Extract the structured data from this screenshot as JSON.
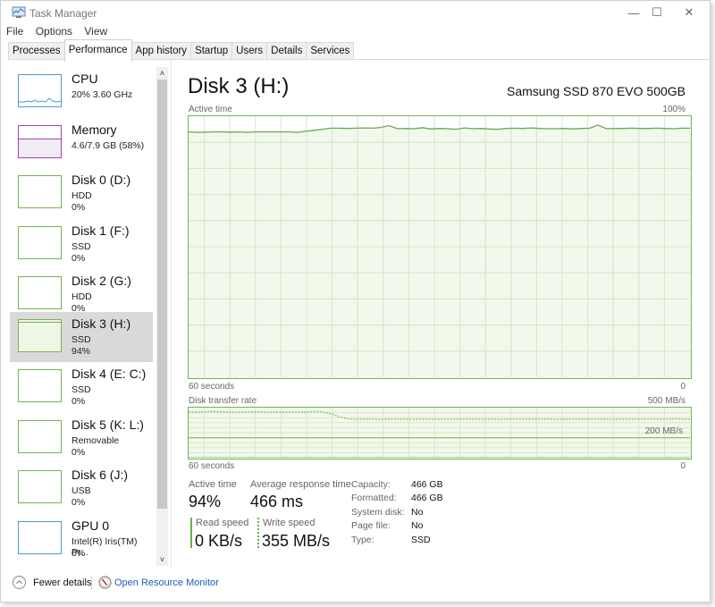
{
  "window": {
    "title": "Task Manager",
    "icons": {
      "app": "task-manager-icon",
      "minimize": "minimize-icon",
      "maximize": "maximize-icon",
      "close": "close-icon"
    },
    "minimize_glyph": "—",
    "maximize_glyph": "☐",
    "close_glyph": "✕"
  },
  "menu": [
    "File",
    "Options",
    "View"
  ],
  "tabs": [
    {
      "label": "Processes",
      "active": false
    },
    {
      "label": "Performance",
      "active": true
    },
    {
      "label": "App history",
      "active": false
    },
    {
      "label": "Startup",
      "active": false
    },
    {
      "label": "Users",
      "active": false
    },
    {
      "label": "Details",
      "active": false
    },
    {
      "label": "Services",
      "active": false
    }
  ],
  "sidebar": {
    "items": [
      {
        "name": "CPU",
        "sub": "20%  3.60 GHz",
        "val": "",
        "kind": "cpu",
        "color": "#4a9bd1",
        "selected": false
      },
      {
        "name": "Memory",
        "sub": "4.6/7.9 GB (58%)",
        "val": "",
        "kind": "memory",
        "color": "#a33eb8",
        "selected": false
      },
      {
        "name": "Disk 0 (D:)",
        "sub": "HDD",
        "val": "0%",
        "kind": "disk",
        "color": "#77b255",
        "selected": false
      },
      {
        "name": "Disk 1 (F:)",
        "sub": "SSD",
        "val": "0%",
        "kind": "disk",
        "color": "#77b255",
        "selected": false
      },
      {
        "name": "Disk 2 (G:)",
        "sub": "HDD",
        "val": "0%",
        "kind": "disk",
        "color": "#77b255",
        "selected": false
      },
      {
        "name": "Disk 3 (H:)",
        "sub": "SSD",
        "val": "94%",
        "kind": "disk",
        "color": "#77b255",
        "selected": true
      },
      {
        "name": "Disk 4 (E: C:)",
        "sub": "SSD",
        "val": "0%",
        "kind": "disk",
        "color": "#77b255",
        "selected": false
      },
      {
        "name": "Disk 5 (K: L:)",
        "sub": "Removable",
        "val": "0%",
        "kind": "disk",
        "color": "#77b255",
        "selected": false
      },
      {
        "name": "Disk 6 (J:)",
        "sub": "USB",
        "val": "0%",
        "kind": "disk",
        "color": "#77b255",
        "selected": false
      },
      {
        "name": "GPU 0",
        "sub": "Intel(R) Iris(TM) Pr...",
        "val": "0%",
        "kind": "gpu",
        "color": "#4a9bd1",
        "selected": false
      }
    ],
    "scroll_up_glyph": "˄",
    "scroll_down_glyph": "˅"
  },
  "main": {
    "title": "Disk 3 (H:)",
    "model": "Samsung SSD 870 EVO 500GB",
    "active_chart": {
      "label": "Active time",
      "max_label": "100%",
      "time_label": "60 seconds",
      "min_label": "0"
    },
    "transfer_chart": {
      "label": "Disk transfer rate",
      "max_label": "500 MB/s",
      "mid_label": "200 MB/s",
      "time_label": "60 seconds",
      "min_label": "0"
    },
    "stats": {
      "active_time_label": "Active time",
      "active_time_value": "94%",
      "avg_resp_label": "Average response time",
      "avg_resp_value": "466 ms",
      "read_label": "Read speed",
      "read_value": "0 KB/s",
      "write_label": "Write speed",
      "write_value": "355 MB/s"
    },
    "properties": [
      {
        "label": "Capacity:",
        "value": "466 GB"
      },
      {
        "label": "Formatted:",
        "value": "466 GB"
      },
      {
        "label": "System disk:",
        "value": "No"
      },
      {
        "label": "Page file:",
        "value": "No"
      },
      {
        "label": "Type:",
        "value": "SSD"
      }
    ]
  },
  "footer": {
    "fewer_details": "Fewer details",
    "open_resource_monitor": "Open Resource Monitor"
  },
  "chart_data": [
    {
      "type": "area",
      "title": "Active time",
      "xlabel": "60 seconds",
      "ylabel": "",
      "ylim": [
        0,
        100
      ],
      "xlim": [
        60,
        0
      ],
      "grid": true,
      "x": [
        60,
        59,
        58,
        57,
        56,
        55,
        54,
        53,
        52,
        51,
        50,
        49,
        48,
        47,
        46,
        45,
        44,
        43,
        42,
        41,
        40,
        39,
        38,
        37,
        36,
        35,
        34,
        33,
        32,
        31,
        30,
        29,
        28,
        27,
        26,
        25,
        24,
        23,
        22,
        21,
        20,
        19,
        18,
        17,
        16,
        15,
        14,
        13,
        12,
        11,
        10,
        9,
        8,
        7,
        6,
        5,
        4,
        3,
        2,
        1,
        0
      ],
      "values": [
        94,
        93.8,
        93.9,
        94,
        94,
        93.9,
        94,
        93.8,
        94,
        94,
        94,
        94,
        94,
        93.8,
        94.2,
        94.6,
        95,
        95.4,
        95.4,
        95.3,
        95.4,
        95.5,
        95.4,
        95.7,
        96.4,
        95.2,
        95.3,
        95.2,
        95.6,
        95.1,
        95.3,
        95.2,
        95,
        95.5,
        95.2,
        95.3,
        95.1,
        95,
        95.3,
        95.4,
        95.3,
        95.5,
        95.3,
        95.2,
        95.2,
        95.3,
        95.1,
        95.3,
        95.4,
        96.6,
        95.2,
        95.3,
        95.3,
        95.4,
        95.3,
        95.3,
        95.4,
        95.3,
        95.2,
        95.4,
        95.4
      ]
    },
    {
      "type": "line",
      "title": "Disk transfer rate",
      "xlabel": "60 seconds",
      "ylabel": "",
      "ylim": [
        0,
        500
      ],
      "xlim": [
        60,
        0
      ],
      "grid": true,
      "series": [
        {
          "name": "Write speed",
          "style": "dotted",
          "values": [
            455,
            456,
            458,
            462,
            458,
            455,
            455,
            456,
            460,
            455,
            455,
            456,
            455,
            455,
            456,
            462,
            458,
            440,
            410,
            390,
            385,
            384,
            386,
            382,
            385,
            384,
            385,
            383,
            386,
            383,
            385,
            384,
            385,
            386,
            384,
            385,
            386,
            383,
            385,
            384,
            386,
            384,
            385,
            386,
            383,
            385,
            384,
            385,
            386,
            384,
            385,
            383,
            385,
            386,
            384,
            385,
            386,
            383,
            388,
            384,
            385
          ]
        },
        {
          "name": "Read speed",
          "style": "solid",
          "values": [
            0,
            0,
            0,
            0,
            0,
            0,
            0,
            0,
            0,
            0,
            0,
            0,
            0,
            0,
            0,
            0,
            0,
            0,
            0,
            0,
            0,
            0,
            0,
            0,
            0,
            0,
            0,
            0,
            0,
            0,
            0,
            0,
            0,
            0,
            0,
            0,
            0,
            0,
            0,
            0,
            0,
            0,
            0,
            0,
            0,
            0,
            0,
            0,
            0,
            0,
            0,
            0,
            0,
            0,
            0,
            0,
            0,
            0,
            0,
            0,
            0
          ]
        }
      ],
      "annotations": [
        "200 MB/s"
      ]
    }
  ]
}
